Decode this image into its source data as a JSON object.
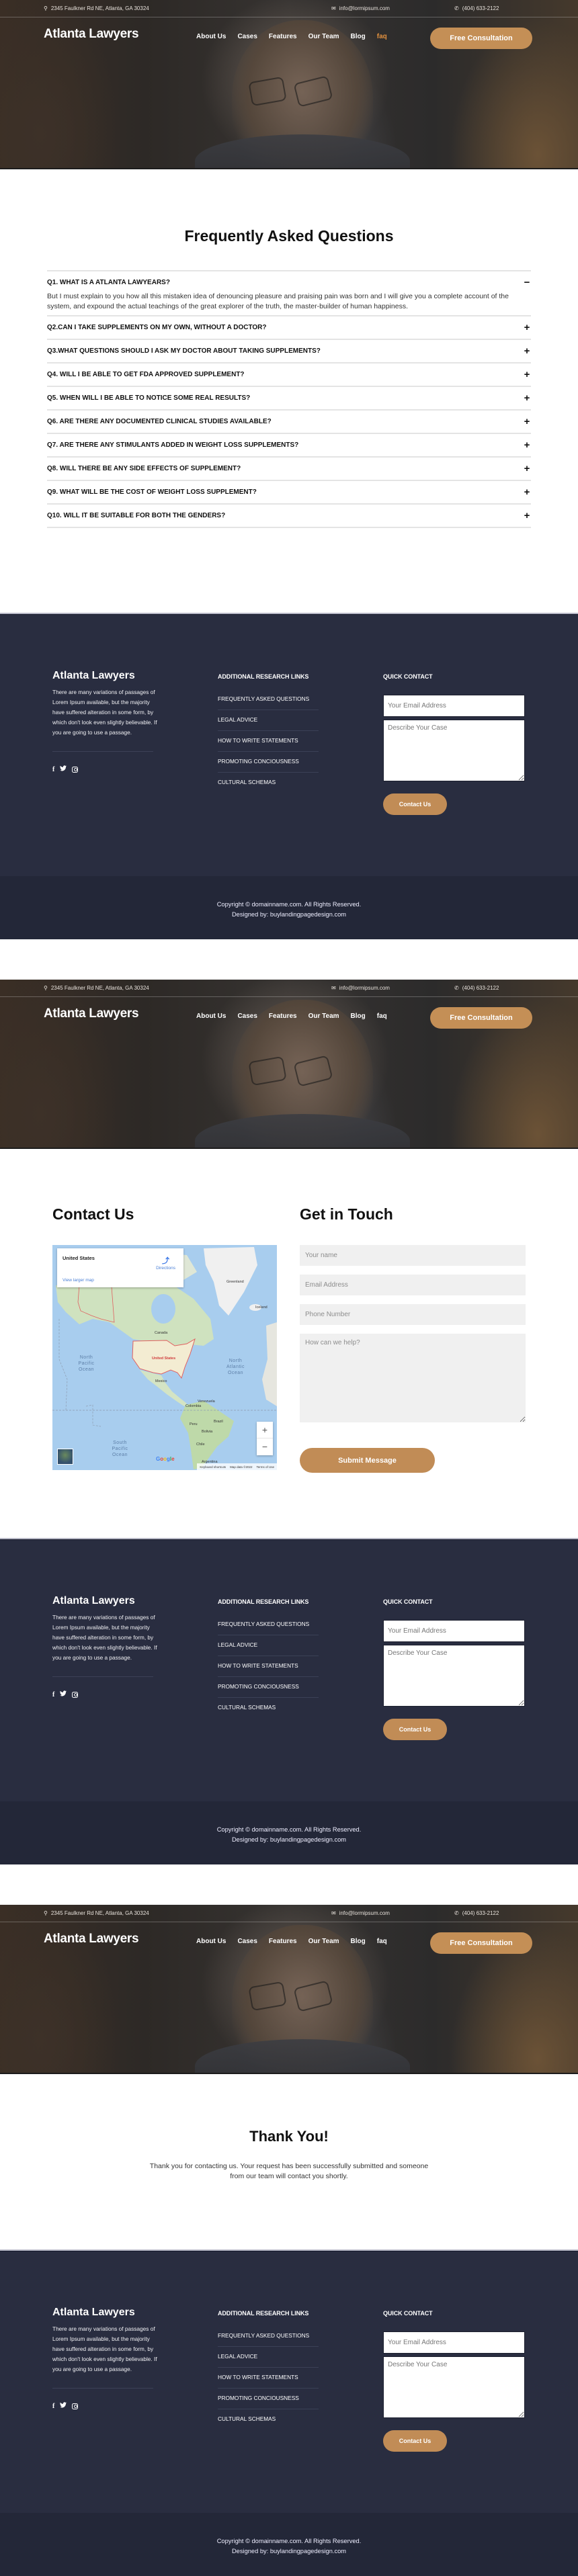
{
  "header": {
    "address": "2345 Faulkner Rd NE, Atlanta, GA 30324",
    "email": "info@lormipsum.com",
    "phone": "(404) 633-2122",
    "logo": "Atlanta Lawyers",
    "nav": [
      "About Us",
      "Cases",
      "Features",
      "Our Team",
      "Blog",
      "faq"
    ],
    "cta": "Free Consultation",
    "icons": {
      "address": "map-pin-icon",
      "email": "envelope-icon",
      "phone": "phone-icon"
    }
  },
  "pages": [
    {
      "name": "faq",
      "active_nav": "faq"
    },
    {
      "name": "contact",
      "active_nav": null
    },
    {
      "name": "thank-you",
      "active_nav": null
    }
  ],
  "faq": {
    "title": "Frequently Asked Questions",
    "items": [
      {
        "q": "Q1. WHAT IS A ATLANTA LAWYEARS?",
        "expanded": true,
        "toggle": "−",
        "a": "But I must explain to you how all this mistaken idea of denouncing pleasure and praising pain was born and I will give you a complete account of the system, and expound the actual teachings of the great explorer of the truth, the master-builder of human happiness."
      },
      {
        "q": "Q2.CAN I TAKE SUPPLEMENTS ON MY OWN, WITHOUT A DOCTOR?",
        "expanded": false,
        "toggle": "+"
      },
      {
        "q": "Q3.WHAT QUESTIONS SHOULD I ASK MY DOCTOR ABOUT TAKING SUPPLEMENTS?",
        "expanded": false,
        "toggle": "+"
      },
      {
        "q": "Q4. WILL I BE ABLE TO GET FDA APPROVED SUPPLEMENT?",
        "expanded": false,
        "toggle": "+"
      },
      {
        "q": "Q5. WHEN WILL I BE ABLE TO NOTICE SOME REAL RESULTS?",
        "expanded": false,
        "toggle": "+"
      },
      {
        "q": "Q6. ARE THERE ANY DOCUMENTED CLINICAL STUDIES AVAILABLE?",
        "expanded": false,
        "toggle": "+"
      },
      {
        "q": "Q7. ARE THERE ANY STIMULANTS ADDED IN WEIGHT LOSS SUPPLEMENTS?",
        "expanded": false,
        "toggle": "+"
      },
      {
        "q": "Q8. WILL THERE BE ANY SIDE EFFECTS OF SUPPLEMENT?",
        "expanded": false,
        "toggle": "+"
      },
      {
        "q": "Q9. WHAT WILL BE THE COST OF WEIGHT LOSS SUPPLEMENT?",
        "expanded": false,
        "toggle": "+"
      },
      {
        "q": "Q10. WILL IT BE SUITABLE FOR BOTH THE GENDERS?",
        "expanded": false,
        "toggle": "+"
      }
    ]
  },
  "contact": {
    "title": "Contact Us",
    "form_title": "Get in Touch",
    "map": {
      "place": "United States",
      "directions": "Directions",
      "view_larger": "View larger map",
      "labels": [
        "Greenland",
        "Iceland",
        "Canada",
        "United States",
        "Mexico",
        "Venezuela",
        "Colombia",
        "Peru",
        "Brazil",
        "Bolivia",
        "Chile",
        "Argentina"
      ],
      "oceans": [
        "North Pacific Ocean",
        "North Atlantic Ocean",
        "South Pacific Ocean"
      ],
      "zoom_in": "+",
      "zoom_out": "−",
      "google": "Google",
      "footer": [
        "Keyboard shortcuts",
        "Map data ©2022",
        "Terms of Use"
      ]
    },
    "fields": {
      "name_placeholder": "Your name",
      "email_placeholder": "Email Address",
      "phone_placeholder": "Phone Number",
      "message_placeholder": "How can we help?"
    },
    "submit": "Submit Message"
  },
  "thanks": {
    "title": "Thank You!",
    "message": "Thank you for contacting us. Your request has been successfully submitted and someone from our team will contact you shortly."
  },
  "footer": {
    "logo": "Atlanta Lawyers",
    "description": "There are many variations of passages of Lorem Ipsum available, but the majority have suffered alteration in some form, by which don't look even slightly believable. If you are going to use a passage.",
    "socials": [
      "facebook-icon",
      "twitter-icon",
      "instagram-icon"
    ],
    "links_title": "ADDITIONAL RESEARCH LINKS",
    "links": [
      "FREQUENTLY ASKED QUESTIONS",
      "LEGAL ADVICE",
      "HOW TO WRITE STATEMENTS",
      "PROMOTING CONCIOUSNESS",
      "CULTURAL SCHEMAS"
    ],
    "quick_title": "QUICK CONTACT",
    "email_placeholder": "Your Email Address",
    "case_placeholder": "Describe Your Case",
    "button": "Contact Us",
    "copyright": "Copyright © domainname.com. All Rights Reserved.",
    "designed_by": "Designed by: buylandingpagedesign.com"
  },
  "colors": {
    "accent": "#c48f56",
    "active_nav": "#e2913e",
    "footer_bg": "#292d40",
    "copyright_bg": "#232738",
    "input_bg": "#f0f0f0"
  }
}
